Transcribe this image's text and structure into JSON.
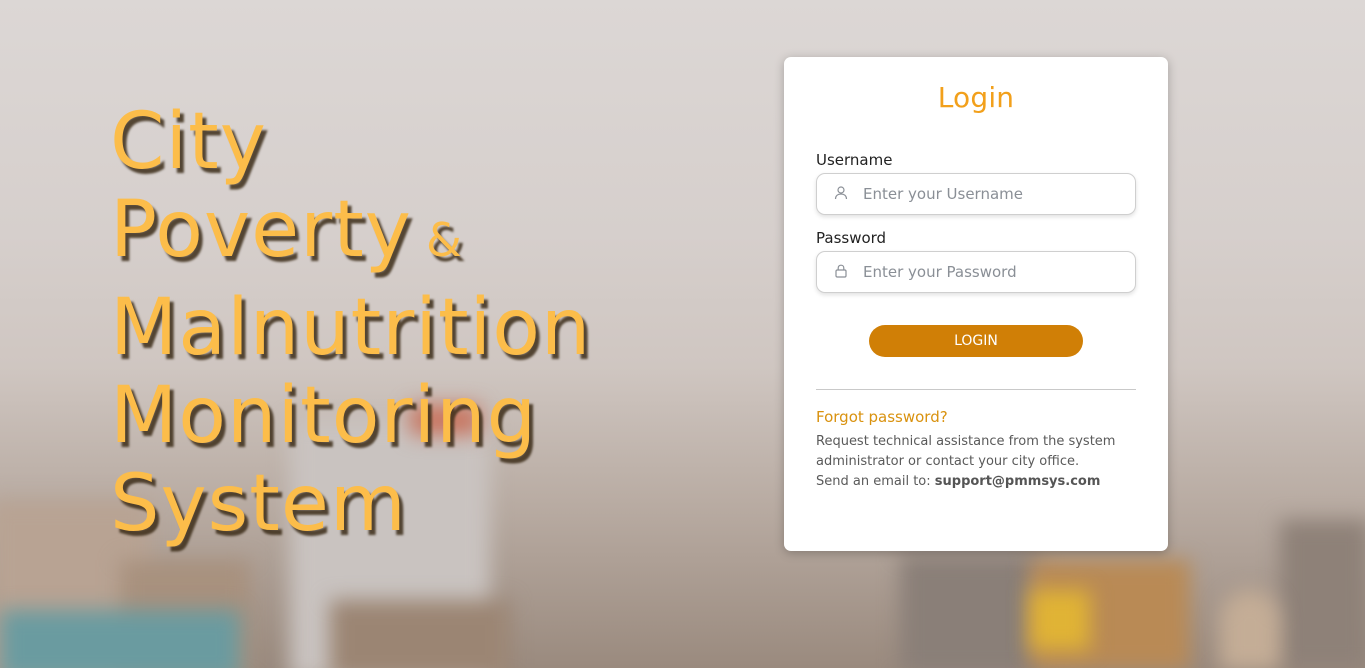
{
  "hero": {
    "line1": "City",
    "line2": "Poverty",
    "amp": "&",
    "line3": "Malnutrition",
    "line4": "Monitoring",
    "line5": "System"
  },
  "login_card": {
    "title": "Login",
    "username_label": "Username",
    "username_placeholder": "Enter your Username",
    "username_value": "",
    "password_label": "Password",
    "password_placeholder": "Enter your Password",
    "password_value": "",
    "login_button": "LOGIN",
    "forgot_link": "Forgot password?",
    "help_text": "Request technical assistance from the system administrator or contact your city office.",
    "email_prefix": "Send an email to: ",
    "email": "support@pmmsys.com"
  },
  "icons": {
    "username": "user-icon",
    "password": "lock-icon"
  },
  "colors": {
    "accent": "#f2a01b",
    "hero_text": "#fcbd4a",
    "button": "#d07f06",
    "forgot_link": "#d9920f"
  }
}
